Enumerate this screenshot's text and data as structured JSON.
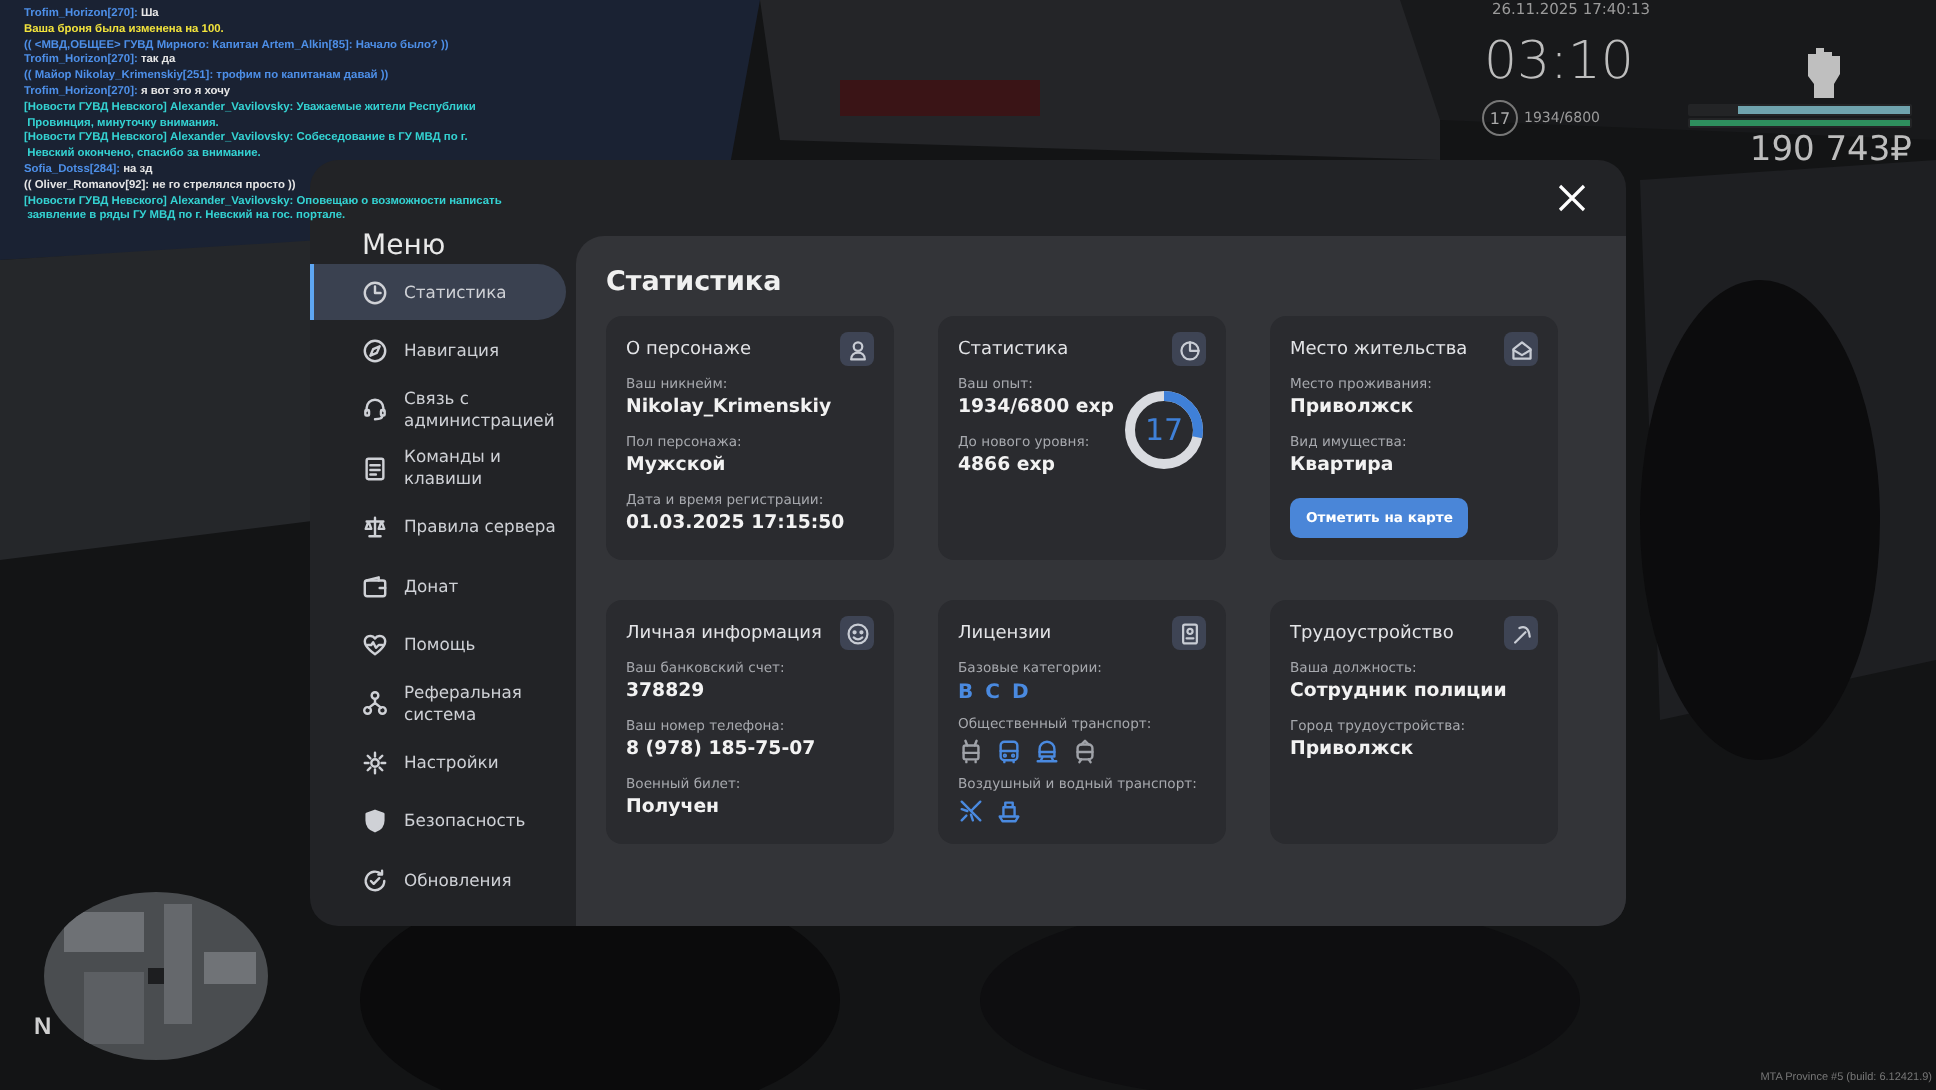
{
  "chat": [
    {
      "parts": [
        {
          "text": "Trofim_Horizon[270]:",
          "color": "#4d8fe8"
        },
        {
          "text": " Ша",
          "color": "#e6e6e6"
        }
      ]
    },
    {
      "parts": [
        {
          "text": "Ваша броня была изменена на 100.",
          "color": "#f2e33c"
        }
      ]
    },
    {
      "parts": [
        {
          "text": "(( <МВД,ОБЩЕЕ> ГУВД Мирного: Капитан Artem_Alkin[85]: Начало было? ))",
          "color": "#4d8fe8"
        }
      ]
    },
    {
      "parts": [
        {
          "text": "Trofim_Horizon[270]:",
          "color": "#4d8fe8"
        },
        {
          "text": " так да",
          "color": "#e6e6e6"
        }
      ]
    },
    {
      "parts": [
        {
          "text": "(( Майор Nikolay_Krimenskiy[251]: трофим по капитанам давай ))",
          "color": "#4d8fe8"
        }
      ]
    },
    {
      "parts": [
        {
          "text": "Trofim_Horizon[270]:",
          "color": "#4d8fe8"
        },
        {
          "text": " я вот это я хочу",
          "color": "#e6e6e6"
        }
      ]
    },
    {
      "parts": [
        {
          "text": "[Новости ГУВД Невского] Alexander_Vavilovsky: Уважаемые жители Республики",
          "color": "#34d3d3"
        }
      ]
    },
    {
      "parts": [
        {
          "text": " Провинция, минуточку внимания.",
          "color": "#34d3d3"
        }
      ]
    },
    {
      "parts": [
        {
          "text": "[Новости ГУВД Невского] Alexander_Vavilovsky: Собеседование в ГУ МВД по г.",
          "color": "#34d3d3"
        }
      ]
    },
    {
      "parts": [
        {
          "text": " Невский окончено, спасибо за внимание.",
          "color": "#34d3d3"
        }
      ]
    },
    {
      "parts": [
        {
          "text": "Sofia_Dotss[284]:",
          "color": "#4d8fe8"
        },
        {
          "text": " на зд",
          "color": "#e6e6e6"
        }
      ]
    },
    {
      "parts": [
        {
          "text": "(( Oliver_Romanov[92]: не го стрелялся просто ))",
          "color": "#e6e6e6"
        }
      ]
    },
    {
      "parts": [
        {
          "text": "[Новости ГУВД Невского] Alexander_Vavilovsky: Оповещаю о возможности написать",
          "color": "#34d3d3"
        }
      ]
    },
    {
      "parts": [
        {
          "text": " заявление в ряды ГУ МВД по г. Невский на гос. портале.",
          "color": "#34d3d3"
        }
      ]
    }
  ],
  "hud": {
    "date": "26.11.2025 17:40:13",
    "time": "03:10",
    "level": "17",
    "experience": "1934/6800",
    "bars": [
      {
        "level": 0.78,
        "color": "#6fa3ad"
      },
      {
        "level": 1,
        "color": "#2e8f5e"
      }
    ],
    "money": "190 743₽",
    "compass": "N",
    "build": "MTA Province #5 (build: 6.12421.9)"
  },
  "menu": {
    "title": "Меню",
    "items": [
      {
        "label": "Статистика",
        "selected": true
      },
      {
        "label": "Навигация",
        "selected": false
      },
      {
        "label": "Связь с администрацией",
        "selected": false
      },
      {
        "label": "Команды и клавиши",
        "selected": false
      },
      {
        "label": "Правила сервера",
        "selected": false
      },
      {
        "label": "Донат",
        "selected": false
      },
      {
        "label": "Помощь",
        "selected": false
      },
      {
        "label": "Реферальная система",
        "selected": false
      },
      {
        "label": "Настройки",
        "selected": false
      },
      {
        "label": "Безопасность",
        "selected": false
      },
      {
        "label": "Обновления",
        "selected": false
      }
    ],
    "page_title": "Статистика",
    "cards": [
      {
        "kind": "fields",
        "title": "О персонаже",
        "fields": [
          {
            "label": "Ваш никнейм:",
            "value": "Nikolay_Krimenskiy"
          },
          {
            "label": "Пол персонажа:",
            "value": "Мужской"
          },
          {
            "label": "Дата и время регистрации:",
            "value": "01.03.2025 17:15:50"
          }
        ]
      },
      {
        "kind": "progress",
        "title": "Статистика",
        "fields": [
          {
            "label": "Ваш опыт:",
            "value": "1934/6800 exp"
          },
          {
            "label": "До нового уровня:",
            "value": "4866 exp"
          }
        ],
        "ring": {
          "value": "17",
          "level": 0.284
        }
      },
      {
        "kind": "fields",
        "title": "Место жительства",
        "fields": [
          {
            "label": "Место проживания:",
            "value": "Приволжск"
          },
          {
            "label": "Вид имущества:",
            "value": "Квартира"
          }
        ],
        "button": "Отметить на карте"
      },
      {
        "kind": "fields",
        "title": "Личная информация",
        "fields": [
          {
            "label": "Ваш банковский счет:",
            "value": "378829"
          },
          {
            "label": "Ваш номер телефона:",
            "value": "8 (978) 185-75-07"
          },
          {
            "label": "Военный билет:",
            "value": "Получен"
          }
        ]
      },
      {
        "kind": "licenses",
        "title": "Лицензии",
        "groups": [
          {
            "label": "Базовые категории:",
            "kind": "letters",
            "items": [
              {
                "text": "B",
                "active": true
              },
              {
                "text": "C",
                "active": true
              },
              {
                "text": "D",
                "active": true
              }
            ]
          },
          {
            "label": "Общественный транспорт:",
            "kind": "icons",
            "items": [
              {
                "active": false
              },
              {
                "active": true
              },
              {
                "active": true
              },
              {
                "active": false
              }
            ]
          },
          {
            "label": "Воздушный и водный транспорт:",
            "kind": "icons",
            "items": [
              {
                "active": true
              },
              {
                "active": true
              }
            ]
          }
        ]
      },
      {
        "kind": "fields",
        "title": "Трудоустройство",
        "fields": [
          {
            "label": "Ваша должность:",
            "value": "Сотрудник полиции"
          },
          {
            "label": "Город трудоустройства:",
            "value": "Приволжск"
          }
        ]
      }
    ]
  }
}
